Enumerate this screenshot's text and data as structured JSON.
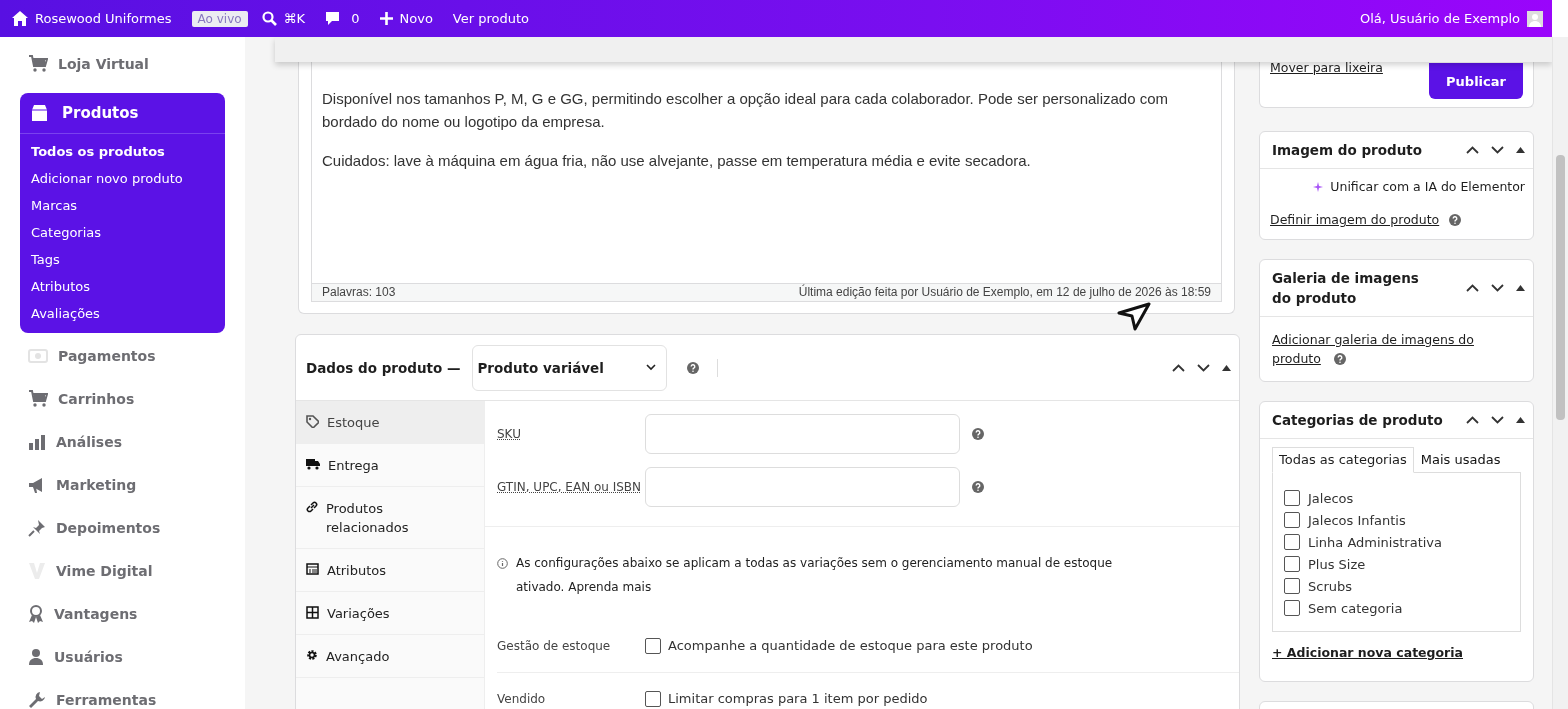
{
  "topbar": {
    "site": "Rosewood Uniformes",
    "badge": "Ao vivo",
    "search_shortcut": "⌘K",
    "comments": "0",
    "new": "Novo",
    "view": "Ver produto",
    "greeting": "Olá, Usuário de Exemplo"
  },
  "sidebar": {
    "items": [
      {
        "label": "Loja Virtual",
        "selected": false
      },
      {
        "label": "Produtos",
        "selected": true,
        "children": [
          {
            "label": "Todos os produtos",
            "selected": true
          },
          {
            "label": "Adicionar novo produto",
            "selected": false
          },
          {
            "label": "Marcas",
            "selected": false
          },
          {
            "label": "Categorias",
            "selected": false
          },
          {
            "label": "Tags",
            "selected": false
          },
          {
            "label": "Atributos",
            "selected": false
          },
          {
            "label": "Avaliações",
            "selected": false
          }
        ]
      },
      {
        "label": "Pagamentos",
        "selected": false
      },
      {
        "label": "Carrinhos",
        "selected": false
      },
      {
        "label": "Análises",
        "selected": false
      },
      {
        "label": "Marketing",
        "selected": false
      },
      {
        "label": "Depoimentos",
        "selected": false
      },
      {
        "label": "Vime Digital",
        "selected": false
      },
      {
        "label": "Vantagens",
        "selected": false
      },
      {
        "label": "Usuários",
        "selected": false
      },
      {
        "label": "Ferramentas",
        "selected": false
      }
    ]
  },
  "editor": {
    "paragraphs": [
      "Disponível nos tamanhos P, M, G e GG, permitindo escolher a opção ideal para cada colaborador. Pode ser personalizado com bordado do nome ou logotipo da empresa.",
      "Cuidados: lave à máquina em água fria, não use alvejante, passe em temperatura média e evite secadora."
    ],
    "word_count": "Palavras: 103",
    "last_edit": "Última edição feita por Usuário de Exemplo, em 12 de julho de 2026 às 18:59"
  },
  "product_data": {
    "title": "Dados do produto —",
    "type": "Produto variável",
    "tabs": [
      {
        "label": "Estoque",
        "selected": true
      },
      {
        "label": "Entrega",
        "selected": false
      },
      {
        "label": "Produtos relacionados",
        "selected": false
      },
      {
        "label": "Atributos",
        "selected": false
      },
      {
        "label": "Variações",
        "selected": false
      },
      {
        "label": "Avançado",
        "selected": false
      }
    ],
    "fields": [
      {
        "label": "SKU"
      },
      {
        "label": "GTIN, UPC, EAN ou ISBN"
      }
    ],
    "notice": "As configurações abaixo se aplicam a todas as variações sem o gerenciamento manual de estoque ativado.",
    "notice_link": "Aprenda mais",
    "options": [
      {
        "label": "Gestão de estoque",
        "text": "Acompanhe a quantidade de estoque para este produto",
        "checked": false
      },
      {
        "label": "Vendido",
        "text": "Limitar compras para 1 item por pedido",
        "checked": false
      }
    ]
  },
  "boxes": [
    {
      "kind": "publish",
      "trash": "Mover para lixeira",
      "button": "Publicar"
    },
    {
      "kind": "image",
      "title": "Imagem do produto",
      "ai": "Unificar com a IA do Elementor",
      "link": "Definir imagem do produto"
    },
    {
      "kind": "gallery",
      "title": "Galeria de imagens do produto",
      "link": "Adicionar galeria de imagens do produto"
    },
    {
      "kind": "categories",
      "title": "Categorias de produto",
      "tabs": [
        {
          "label": "Todas as categorias",
          "selected": true
        },
        {
          "label": "Mais usadas",
          "selected": false
        }
      ],
      "items": [
        {
          "label": "Jalecos",
          "checked": false
        },
        {
          "label": "Jalecos Infantis",
          "checked": false
        },
        {
          "label": "Linha Administrativa",
          "checked": false
        },
        {
          "label": "Plus Size",
          "checked": false
        },
        {
          "label": "Scrubs",
          "checked": false
        },
        {
          "label": "Sem categoria",
          "checked": false
        }
      ],
      "add": "+ Adicionar nova categoria"
    }
  ]
}
